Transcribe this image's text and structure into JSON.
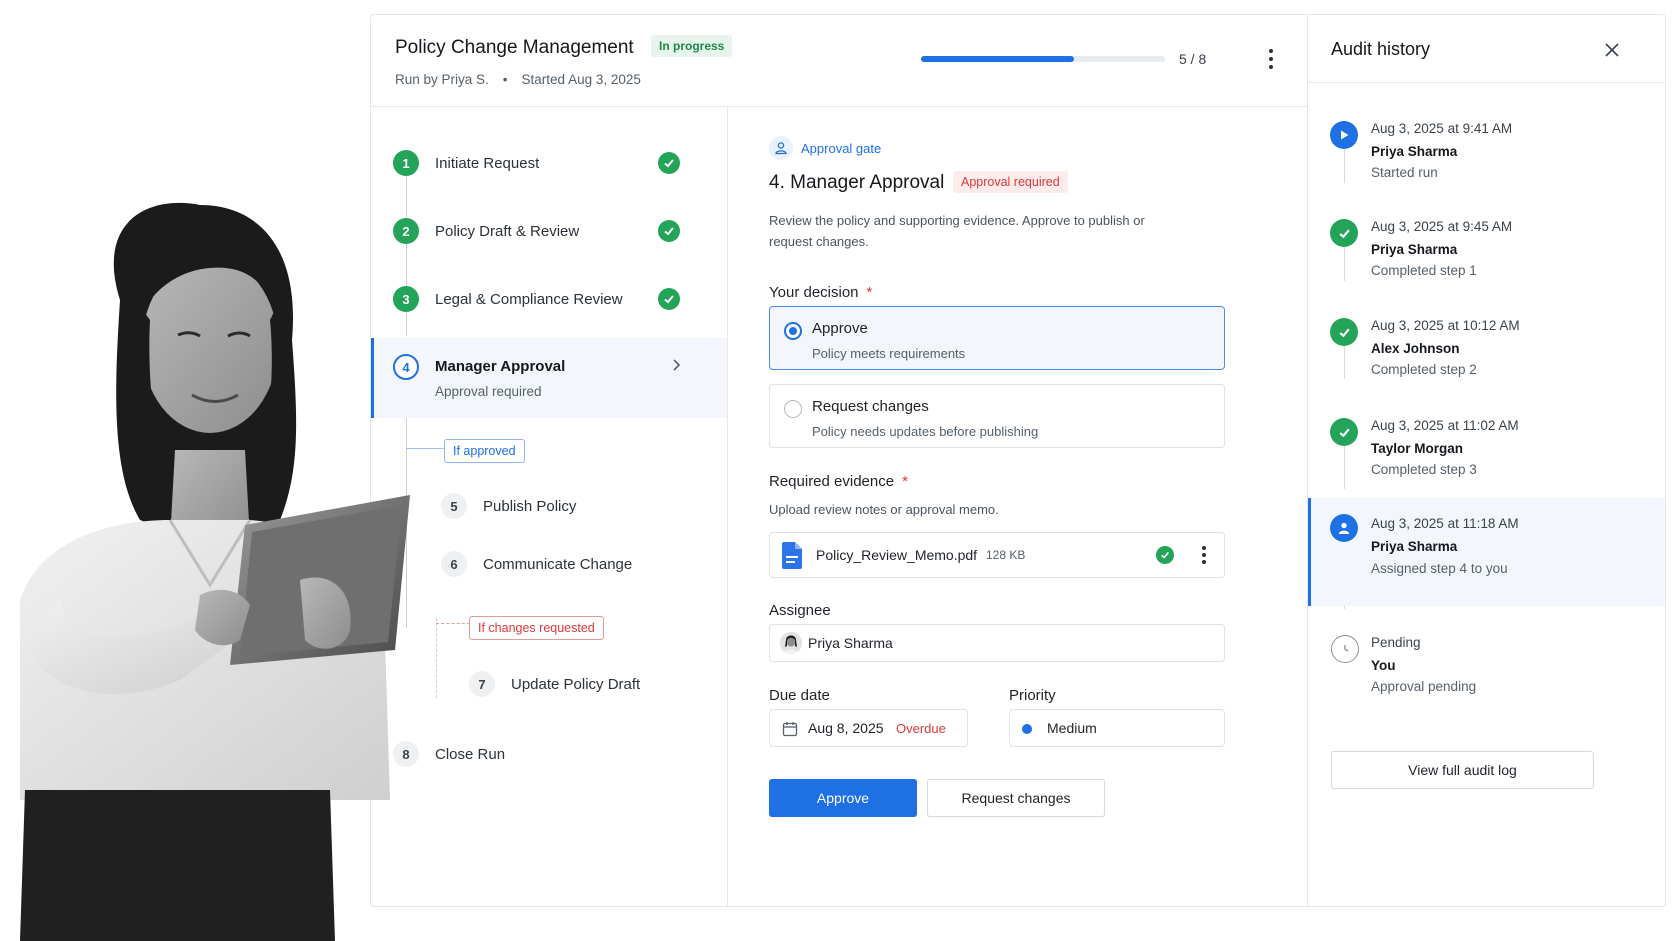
{
  "header": {
    "title": "Policy Change Management",
    "status_badge": "In progress",
    "run_by": "Run by Priya S.",
    "separator": "•",
    "started": "Started Aug 3, 2025",
    "progress_fraction": 0.625,
    "progress_text": "5 / 8"
  },
  "steps": [
    {
      "number": "1",
      "label": "Initiate Request",
      "state": "done"
    },
    {
      "number": "2",
      "label": "Policy Draft & Review",
      "state": "done"
    },
    {
      "number": "3",
      "label": "Legal & Compliance Review",
      "state": "done"
    },
    {
      "number": "4",
      "label": "Manager Approval",
      "sub": "Approval required",
      "state": "active"
    },
    {
      "number": "5",
      "label": "Publish Policy",
      "state": "todo"
    },
    {
      "number": "6",
      "label": "Communicate Change",
      "state": "todo"
    },
    {
      "number": "7",
      "label": "Update Policy Draft",
      "state": "todo"
    },
    {
      "number": "8",
      "label": "Close Run",
      "state": "todo"
    }
  ],
  "branches": {
    "approved": "If approved",
    "changes": "If changes requested"
  },
  "form": {
    "gate_label": "Approval gate",
    "title": "4. Manager Approval",
    "badge": "Approval required",
    "description": "Review the policy and supporting evidence. Approve to publish or request changes.",
    "decision_label": "Your decision",
    "required_mark": "*",
    "options": [
      {
        "title": "Approve",
        "sub": "Policy meets requirements",
        "selected": true
      },
      {
        "title": "Request changes",
        "sub": "Policy needs updates before publishing",
        "selected": false
      }
    ],
    "evidence_label": "Required evidence",
    "evidence_hint": "Upload review notes or approval memo.",
    "file": {
      "name": "Policy_Review_Memo.pdf",
      "size": "128 KB"
    },
    "assignee_label": "Assignee",
    "assignee": "Priya Sharma",
    "due_label": "Due date",
    "due_value": "Aug 8, 2025",
    "due_status": "Overdue",
    "priority_label": "Priority",
    "priority_value": "Medium",
    "approve_button": "Approve",
    "request_button": "Request changes"
  },
  "audit": {
    "title": "Audit history",
    "events": [
      {
        "time": "Aug 3, 2025 at 9:41 AM",
        "name": "Priya Sharma",
        "action": "Started run",
        "icon": "play-icon"
      },
      {
        "time": "Aug 3, 2025 at 9:45 AM",
        "name": "Priya Sharma",
        "action": "Completed step 1",
        "icon": "check-icon"
      },
      {
        "time": "Aug 3, 2025 at 10:12 AM",
        "name": "Alex Johnson",
        "action": "Completed step 2",
        "icon": "check-icon"
      },
      {
        "time": "Aug 3, 2025 at 11:02 AM",
        "name": "Taylor Morgan",
        "action": "Completed step 3",
        "icon": "check-icon"
      },
      {
        "time": "Aug 3, 2025 at 11:18 AM",
        "name": "Priya Sharma",
        "action": "Assigned step 4 to you",
        "icon": "user-icon"
      },
      {
        "time": "Pending",
        "name": "You",
        "action": "Approval pending",
        "icon": "clock-icon"
      }
    ],
    "view_log_button": "View full audit log"
  },
  "colors": {
    "accent": "#1f6fe5",
    "success": "#23a458",
    "danger": "#d93a3a"
  }
}
